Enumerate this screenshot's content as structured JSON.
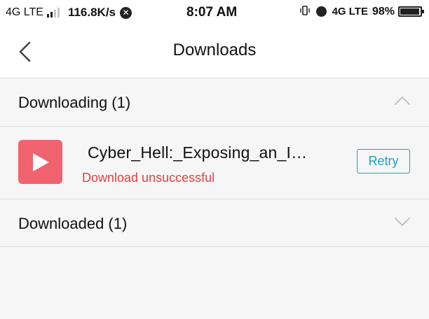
{
  "status_bar": {
    "network_left": "4G LTE",
    "speed": "116.8K/s",
    "time": "8:07 AM",
    "network_right": "4G LTE",
    "battery": "98%"
  },
  "nav": {
    "title": "Downloads"
  },
  "downloading_section": {
    "label": "Downloading (1)"
  },
  "item": {
    "title": "Cyber_Hell:_Exposing_an_I…",
    "status": "Download unsuccessful",
    "retry_label": "Retry",
    "thumb_color": "#f0626e",
    "status_color": "#e0413f",
    "accent_color": "#1aa3c0"
  },
  "downloaded_section": {
    "label": "Downloaded (1)"
  }
}
